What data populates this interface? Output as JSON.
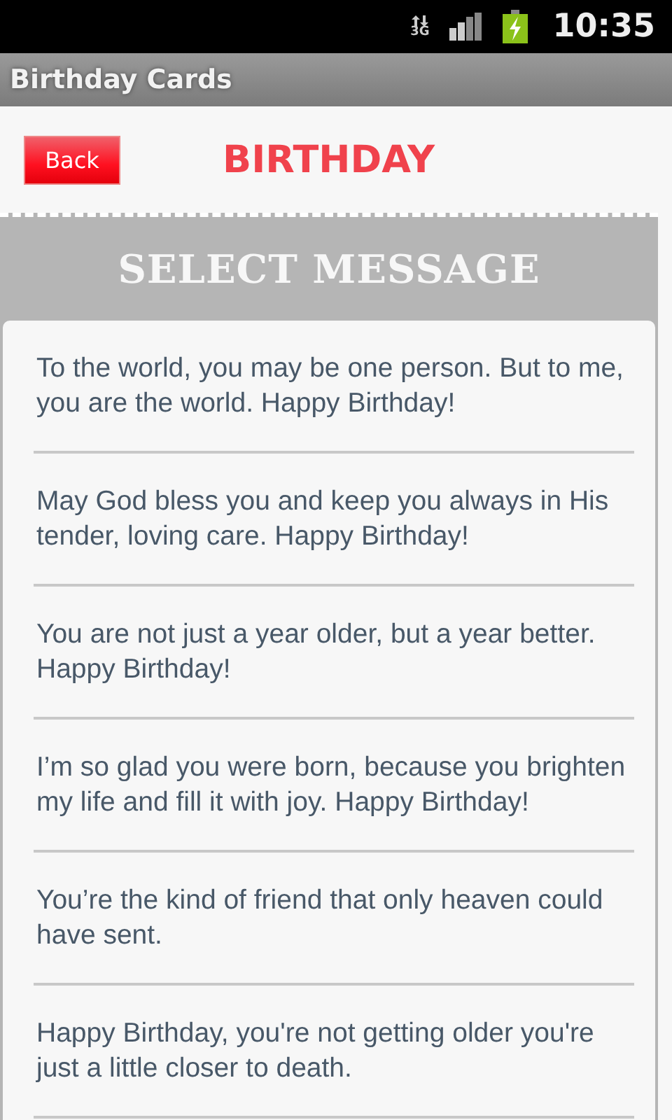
{
  "status_bar": {
    "network": "3G",
    "time": "10:35"
  },
  "window": {
    "title": "Birthday Cards"
  },
  "header": {
    "back_button": "Back",
    "title": "BIRTHDAY"
  },
  "section": {
    "title": "SELECT MESSAGE"
  },
  "messages": [
    {
      "text": "To the world, you may be one person. But to me, you are the world. Happy Birthday!"
    },
    {
      "text": "May God bless you and keep you always in His tender, loving care. Happy Birthday!"
    },
    {
      "text": "You are not just a year older, but a year better. Happy Birthday!"
    },
    {
      "text": "I’m so glad you were born, because you brighten my life and fill it with joy. Happy Birthday!"
    },
    {
      "text": "You’re the kind of friend that only heaven could have sent."
    },
    {
      "text": "Happy Birthday, you're not getting older you're just a little closer to death."
    }
  ]
}
